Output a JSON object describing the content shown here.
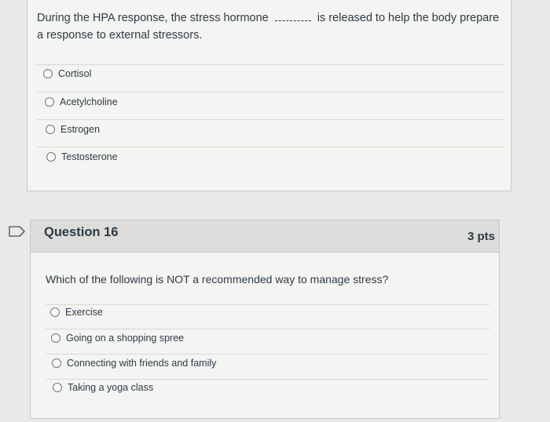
{
  "q15": {
    "prompt_before": "During the HPA response, the stress hormone",
    "prompt_after": "is released to help the body prepare a response to external stressors.",
    "answers": [
      "Cortisol",
      "Acetylcholine",
      "Estrogen",
      "Testosterone"
    ]
  },
  "q16": {
    "title": "Question 16",
    "points": "3 pts",
    "prompt": "Which of the following is NOT a recommended way to manage stress?",
    "answers": [
      "Exercise",
      "Going on a shopping spree",
      "Connecting with friends and family",
      "Taking a yoga class"
    ]
  },
  "colors": {
    "accent": "#2d3b45",
    "flag": "#5b6b77"
  },
  "icons": {
    "flag": "bookmark-flag-icon",
    "radio": "radio-circle-icon"
  }
}
